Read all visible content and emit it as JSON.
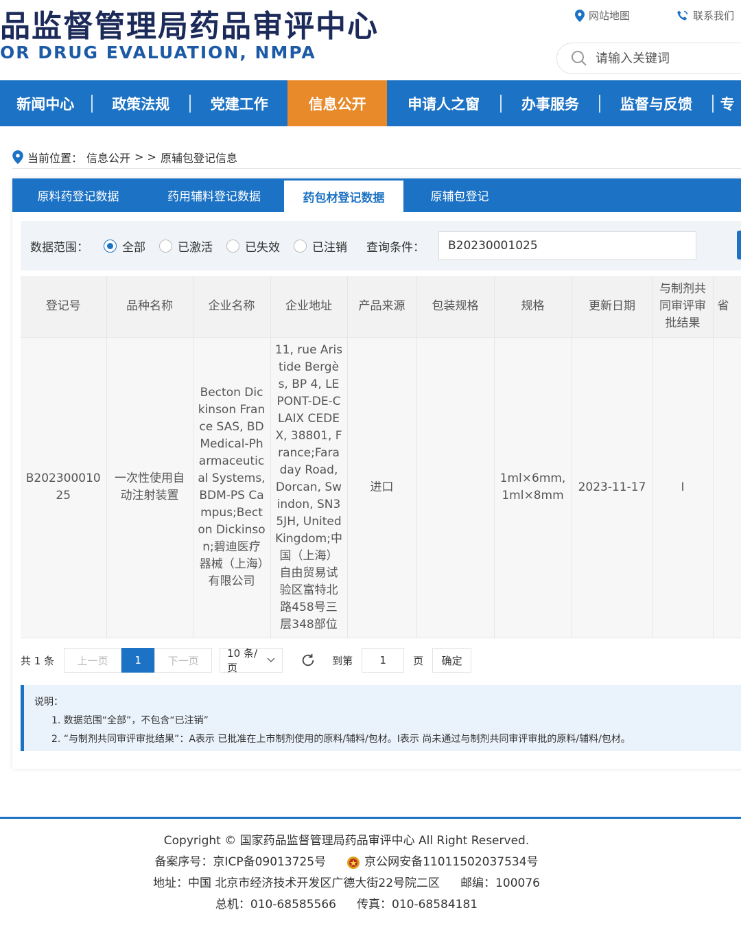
{
  "header": {
    "title_cn": "品监督管理局药品审评中心",
    "title_en": "OR DRUG EVALUATION, NMPA",
    "site_map": "网站地图",
    "contact": "联系我们",
    "search_placeholder": "请输入关键词"
  },
  "nav": {
    "items": [
      {
        "label": "新闻中心"
      },
      {
        "label": "政策法规"
      },
      {
        "label": "党建工作"
      },
      {
        "label": "信息公开"
      },
      {
        "label": "申请人之窗"
      },
      {
        "label": "办事服务"
      },
      {
        "label": "监督与反馈"
      },
      {
        "label": "专"
      }
    ],
    "active_index": 3
  },
  "breadcrumb": {
    "prefix": "当前位置：",
    "parent": "信息公开",
    "separator": "> >",
    "current": "原辅包登记信息"
  },
  "tabs": [
    {
      "label": "原料药登记数据"
    },
    {
      "label": "药用辅料登记数据"
    },
    {
      "label": "药包材登记数据"
    },
    {
      "label": "原辅包登记"
    }
  ],
  "filter": {
    "range_label": "数据范围：",
    "options": [
      "全部",
      "已激活",
      "已失效",
      "已注销"
    ],
    "selected": "全部",
    "query_label": "查询条件：",
    "query_value": "B20230001025"
  },
  "table": {
    "headers": [
      "登记号",
      "品种名称",
      "企业名称",
      "企业地址",
      "产品来源",
      "包装规格",
      "规格",
      "更新日期",
      "与制剂共同审评审批结果",
      "省"
    ],
    "rows": [
      {
        "reg_no": "B20230001025",
        "name": "一次性使用自动注射装置",
        "company": "Becton Dickinson France SAS, BD Medical-Pharmaceutical Systems, BDM-PS Campus;Becton Dickinson;碧迪医疗器械（上海）有限公司",
        "address": "11, rue Aristide Bergès, BP 4, LE PONT-DE-CLAIX CEDEX, 38801, France;Faraday Road, Dorcan, Swindon, SN3 5JH, United Kingdom;中国（上海）自由贸易试验区富特北路458号三层348部位",
        "source": "进口",
        "package": "",
        "spec": "1ml×6mm, 1ml×8mm",
        "date": "2023-11-17",
        "result": "I",
        "province": ""
      }
    ]
  },
  "pager": {
    "total": "共 1 条",
    "prev": "上一页",
    "current": "1",
    "next": "下一页",
    "page_size": "10 条/页",
    "goto_label": "到第",
    "goto_value": "1",
    "page_unit": "页",
    "confirm": "确定"
  },
  "notes": {
    "title": "说明：",
    "line1": "1. 数据范围“全部”，不包含“已注销”",
    "line2": "2. “与制剂共同审评审批结果”：A表示 已批准在上市制剂使用的原料/辅料/包材。I表示 尚未通过与制剂共同审评审批的原料/辅料/包材。"
  },
  "footer": {
    "copyright": "Copyright © 国家药品监督管理局药品审评中心    All Right Reserved.",
    "icp": "备案序号：京ICP备09013725号",
    "gongan": "京公网安备11011502037534号",
    "address": "地址：中国 北京市经济技术开发区广德大街22号院二区",
    "postcode": "邮编：100076",
    "phone": "总机：010-68585566",
    "fax": "传真：010-68584181"
  },
  "colors": {
    "primary": "#1c72c4",
    "active_nav": "#e8892a",
    "title": "#1c2a5a"
  }
}
